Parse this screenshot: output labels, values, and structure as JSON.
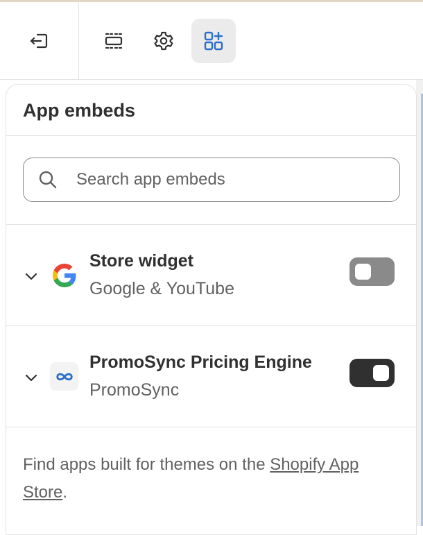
{
  "toolbar": {
    "buttons": [
      {
        "icon": "exit-icon",
        "active": false
      },
      {
        "icon": "sections-icon",
        "active": false
      },
      {
        "icon": "gear-icon",
        "active": false
      },
      {
        "icon": "apps-add-icon",
        "active": true
      }
    ],
    "accent_color": "#2c6ecb"
  },
  "panel": {
    "title": "App embeds",
    "search": {
      "placeholder": "Search app embeds",
      "value": ""
    }
  },
  "embeds": [
    {
      "title": "Store widget",
      "subtitle": "Google & YouTube",
      "logo": "google-logo",
      "enabled": false
    },
    {
      "title": "PromoSync Pricing Engine",
      "subtitle": "PromoSync",
      "logo": "infinity-icon",
      "enabled": true
    }
  ],
  "footer": {
    "text": "Find apps built for themes on the ",
    "link_text": "Shopify App Store",
    "end": "."
  }
}
